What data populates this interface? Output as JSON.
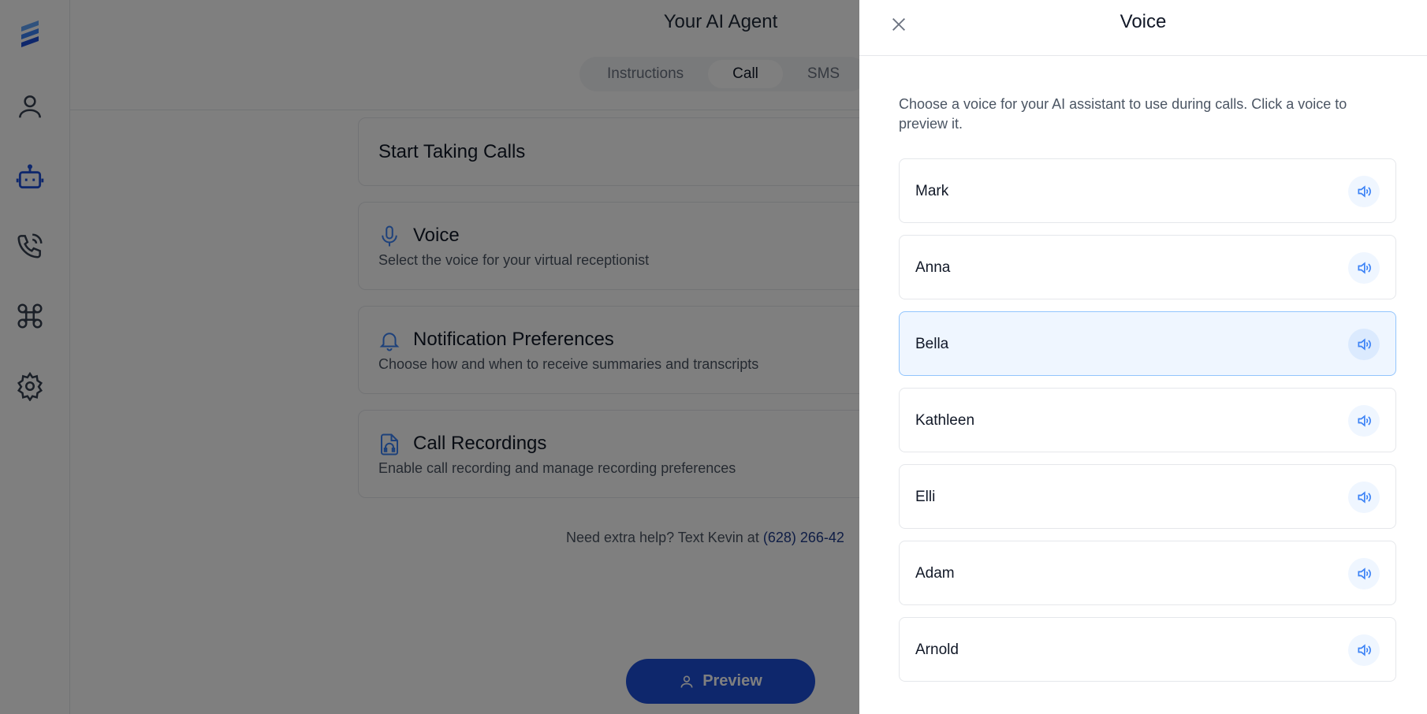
{
  "app": {
    "page_title": "Your AI Agent"
  },
  "sidebar": {
    "items": [
      {
        "icon": "user-icon"
      },
      {
        "icon": "robot-icon",
        "active": true
      },
      {
        "icon": "phone-icon"
      },
      {
        "icon": "command-icon"
      },
      {
        "icon": "settings-icon"
      }
    ]
  },
  "tabs": [
    {
      "label": "Instructions",
      "active": false
    },
    {
      "label": "Call",
      "active": true
    },
    {
      "label": "SMS",
      "active": false
    }
  ],
  "cards": {
    "start": {
      "title": "Start Taking Calls"
    },
    "voice": {
      "title": "Voice",
      "description": "Select the voice for your virtual receptionist",
      "icon": "microphone-icon"
    },
    "notifications": {
      "title": "Notification Preferences",
      "description": "Choose how and when to receive summaries and transcripts",
      "icon": "bell-icon"
    },
    "recordings": {
      "title": "Call Recordings",
      "description": "Enable call recording and manage recording preferences",
      "icon": "file-audio-icon"
    }
  },
  "help": {
    "text": "Need extra help? Text Kevin at ",
    "phone": "(628) 266-42"
  },
  "preview_button": {
    "label": "Preview",
    "icon": "user-icon"
  },
  "drawer": {
    "title": "Voice",
    "description": "Choose a voice for your AI assistant to use during calls. Click a voice to preview it.",
    "voices": [
      {
        "name": "Mark",
        "selected": false
      },
      {
        "name": "Anna",
        "selected": false
      },
      {
        "name": "Bella",
        "selected": true
      },
      {
        "name": "Kathleen",
        "selected": false
      },
      {
        "name": "Elli",
        "selected": false
      },
      {
        "name": "Adam",
        "selected": false
      },
      {
        "name": "Arnold",
        "selected": false
      }
    ]
  },
  "colors": {
    "accent": "#1d4ed8",
    "overlay": "rgba(0,0,0,0.5)",
    "selected_bg": "#eff6ff"
  }
}
